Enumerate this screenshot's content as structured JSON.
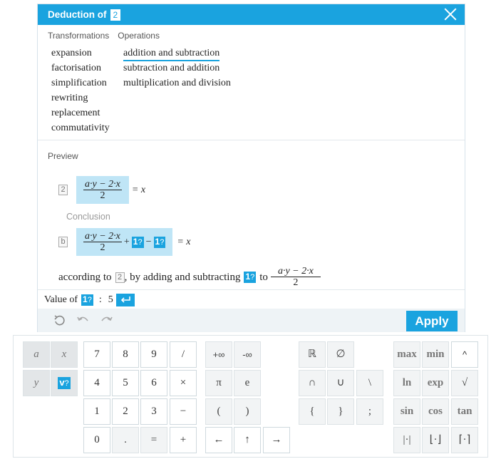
{
  "dialog": {
    "title": "Deduction of",
    "title_ref": "2",
    "sections": {
      "transformations": "Transformations",
      "operations": "Operations"
    },
    "transformations": [
      "expansion",
      "factorisation",
      "simplification",
      "rewriting",
      "replacement",
      "commutativity"
    ],
    "operations": [
      "addition and subtraction",
      "subtraction and addition",
      "multiplication and division"
    ],
    "selected_operation": "addition and subtraction",
    "preview_label": "Preview",
    "premise": {
      "ref": "2",
      "numerator": "a·y − 2·x",
      "denominator": "2",
      "rhs": "= x"
    },
    "conclusion_label": "Conclusion",
    "conclusion": {
      "ref": "b",
      "numerator": "a·y − 2·x",
      "denominator": "2",
      "plus": "+",
      "minus": "−",
      "placeholder": "1",
      "placeholder_q": "?",
      "rhs": "= x"
    },
    "according": {
      "text1": "according to",
      "ref": "2",
      "text2": ", by adding and subtracting",
      "placeholder": "1",
      "placeholder_q": "?",
      "text3": "to",
      "numerator": "a·y − 2·x",
      "denominator": "2"
    },
    "value_row": {
      "label": "Value of",
      "placeholder": "1",
      "placeholder_q": "?",
      "colon": ":",
      "value": "5"
    },
    "apply_label": "Apply"
  },
  "keyboard": {
    "keys": {
      "a": "a",
      "x": "x",
      "y": "y",
      "v": "v",
      "vq": "?",
      "n7": "7",
      "n8": "8",
      "n9": "9",
      "div": "/",
      "n4": "4",
      "n5": "5",
      "n6": "6",
      "mul": "×",
      "n1": "1",
      "n2": "2",
      "n3": "3",
      "sub": "−",
      "n0": "0",
      "dot": ".",
      "eq": "=",
      "add": "+",
      "pinf": "+∞",
      "minf": "-∞",
      "pi": "π",
      "e": "e",
      "lpar": "(",
      "rpar": ")",
      "left": "←",
      "up": "↑",
      "right": "→",
      "reals": "ℝ",
      "empty": "∅",
      "cap": "∩",
      "cup": "∪",
      "setminus": "\\",
      "lbrace": "{",
      "rbrace": "}",
      "semicolon": ";",
      "max": "max",
      "min": "min",
      "caret": "^",
      "ln": "ln",
      "exp": "exp",
      "sqrt": "√",
      "sin": "sin",
      "cos": "cos",
      "tan": "tan",
      "abs": "|·|",
      "floor": "⌊·⌋",
      "ceil": "⌈·⌉"
    }
  }
}
